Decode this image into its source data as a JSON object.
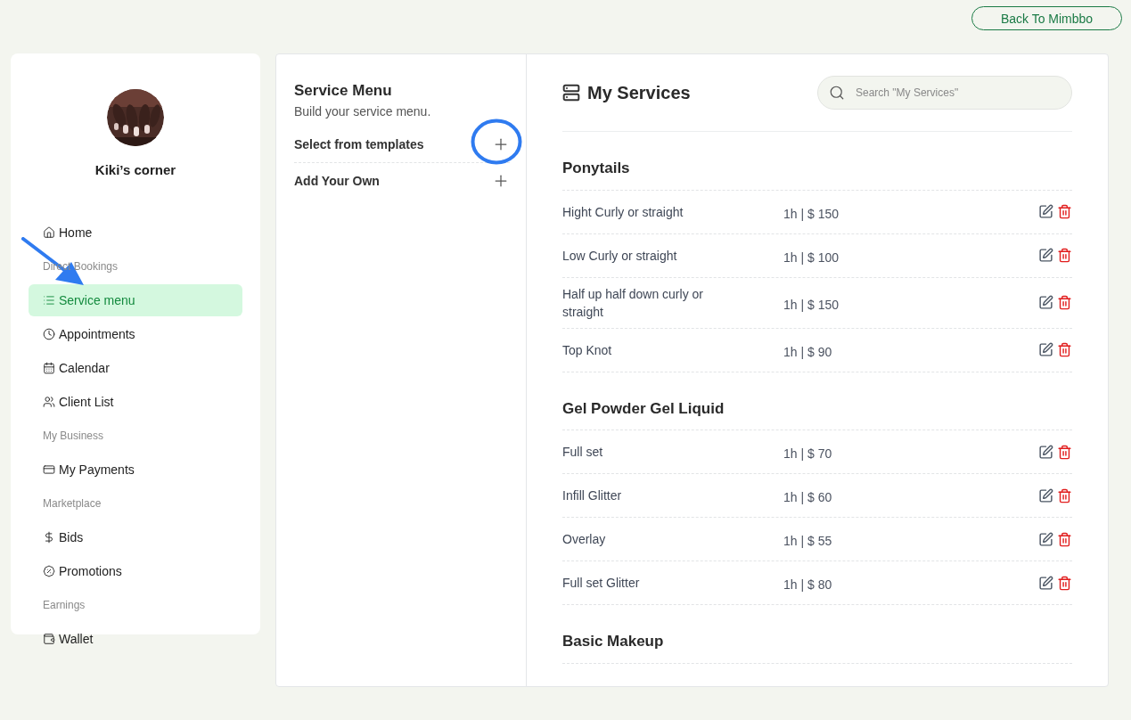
{
  "header": {
    "back_button": "Back To Mimbbo"
  },
  "sidebar": {
    "profile_name": "Kiki’s corner",
    "nav": [
      {
        "kind": "item",
        "label": "Home",
        "selected": false
      },
      {
        "kind": "section",
        "label": "Direct Bookings"
      },
      {
        "kind": "item",
        "label": "Service menu",
        "selected": true
      },
      {
        "kind": "item",
        "label": "Appointments",
        "selected": false
      },
      {
        "kind": "item",
        "label": "Calendar",
        "selected": false
      },
      {
        "kind": "item",
        "label": "Client List",
        "selected": false
      },
      {
        "kind": "section",
        "label": "My Business"
      },
      {
        "kind": "item",
        "label": "My Payments",
        "selected": false
      },
      {
        "kind": "section",
        "label": "Marketplace"
      },
      {
        "kind": "item",
        "label": "Bids",
        "selected": false
      },
      {
        "kind": "item",
        "label": "Promotions",
        "selected": false
      },
      {
        "kind": "section",
        "label": "Earnings"
      },
      {
        "kind": "item",
        "label": "Wallet",
        "selected": false
      }
    ]
  },
  "builder": {
    "title": "Service Menu",
    "subtitle": "Build your service menu.",
    "options": [
      {
        "label": "Select from templates"
      },
      {
        "label": "Add Your Own"
      }
    ]
  },
  "services": {
    "title": "My Services",
    "search": {
      "placeholder": "Search \"My Services\""
    },
    "categories": [
      {
        "name": "Ponytails",
        "services": [
          {
            "name": "Hight Curly or straight",
            "price": "1h | $ 150"
          },
          {
            "name": "Low Curly or straight",
            "price": "1h | $ 100"
          },
          {
            "name": "Half up half down curly or straight",
            "price": "1h | $ 150"
          },
          {
            "name": "Top Knot",
            "price": "1h | $ 90"
          }
        ]
      },
      {
        "name": "Gel Powder Gel Liquid",
        "services": [
          {
            "name": "Full set",
            "price": "1h | $ 70"
          },
          {
            "name": "Infill Glitter",
            "price": "1h | $ 60"
          },
          {
            "name": "Overlay",
            "price": "1h | $ 55"
          },
          {
            "name": "Full set Glitter",
            "price": "1h | $ 80"
          }
        ]
      },
      {
        "name": "Basic Makeup"
      }
    ]
  }
}
